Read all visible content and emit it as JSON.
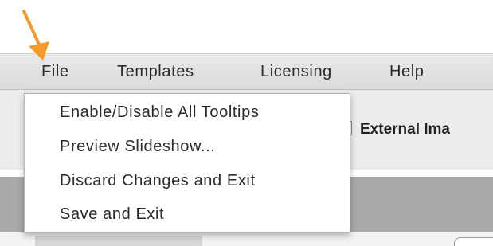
{
  "menubar": {
    "items": [
      {
        "label": "File"
      },
      {
        "label": "Templates"
      },
      {
        "label": "Licensing"
      },
      {
        "label": "Help"
      }
    ]
  },
  "toolbar": {
    "external_image_label": "External Ima"
  },
  "file_menu": {
    "items": [
      {
        "label": "Enable/Disable All Tooltips"
      },
      {
        "label": "Preview Slideshow..."
      },
      {
        "label": "Discard Changes and Exit"
      },
      {
        "label": "Save and Exit"
      }
    ]
  },
  "annotation": {
    "arrow_icon": "orange-pointer-arrow-icon",
    "arrow_color": "#f39a2a"
  },
  "colors": {
    "menubar_bg": "#dedede",
    "dropdown_bg": "#ffffff",
    "panel_band": "#a9a9a9"
  }
}
